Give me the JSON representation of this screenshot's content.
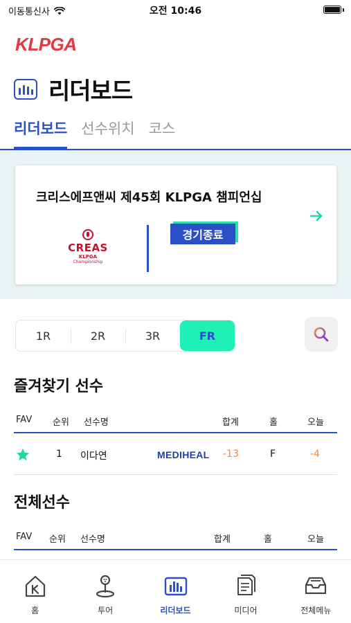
{
  "status_bar": {
    "carrier": "이동통신사",
    "time": "오전 10:46"
  },
  "brand": {
    "logo_text": "KLPGA",
    "accent": "#2b4fc7",
    "logo_color": "#e8363d"
  },
  "header": {
    "title": "리더보드",
    "icon": "leaderboard-icon"
  },
  "tabs": [
    {
      "label": "리더보드",
      "active": true
    },
    {
      "label": "선수위치",
      "active": false
    },
    {
      "label": "코스",
      "active": false
    }
  ],
  "event": {
    "title": "크리스에프앤씨 제45회 KLPGA 챔피언십",
    "status": "경기종료",
    "logo": {
      "name": "CREAS",
      "line1": "KLPGA",
      "line2": "Championship"
    }
  },
  "rounds": [
    {
      "label": "1R",
      "active": false
    },
    {
      "label": "2R",
      "active": false
    },
    {
      "label": "3R",
      "active": false
    },
    {
      "label": "FR",
      "active": true
    }
  ],
  "favorites": {
    "title": "즐겨찾기 선수",
    "columns": [
      "FAV",
      "순위",
      "선수명",
      "합계",
      "홀",
      "오늘"
    ],
    "rows": [
      {
        "rank": "1",
        "name": "이다연",
        "sponsor": "MEDIHEAL",
        "total": "-13",
        "hole": "F",
        "today": "-4"
      }
    ]
  },
  "all_players": {
    "title": "전체선수",
    "columns": [
      "FAV",
      "순위",
      "선수명",
      "합계",
      "홀",
      "오늘"
    ]
  },
  "bottom_nav": [
    {
      "label": "홈",
      "icon": "home-icon",
      "active": false
    },
    {
      "label": "투어",
      "icon": "golf-tour-icon",
      "active": false
    },
    {
      "label": "리더보드",
      "icon": "leaderboard-icon",
      "active": true
    },
    {
      "label": "미디어",
      "icon": "media-icon",
      "active": false
    },
    {
      "label": "전체메뉴",
      "icon": "inbox-menu-icon",
      "active": false
    }
  ]
}
